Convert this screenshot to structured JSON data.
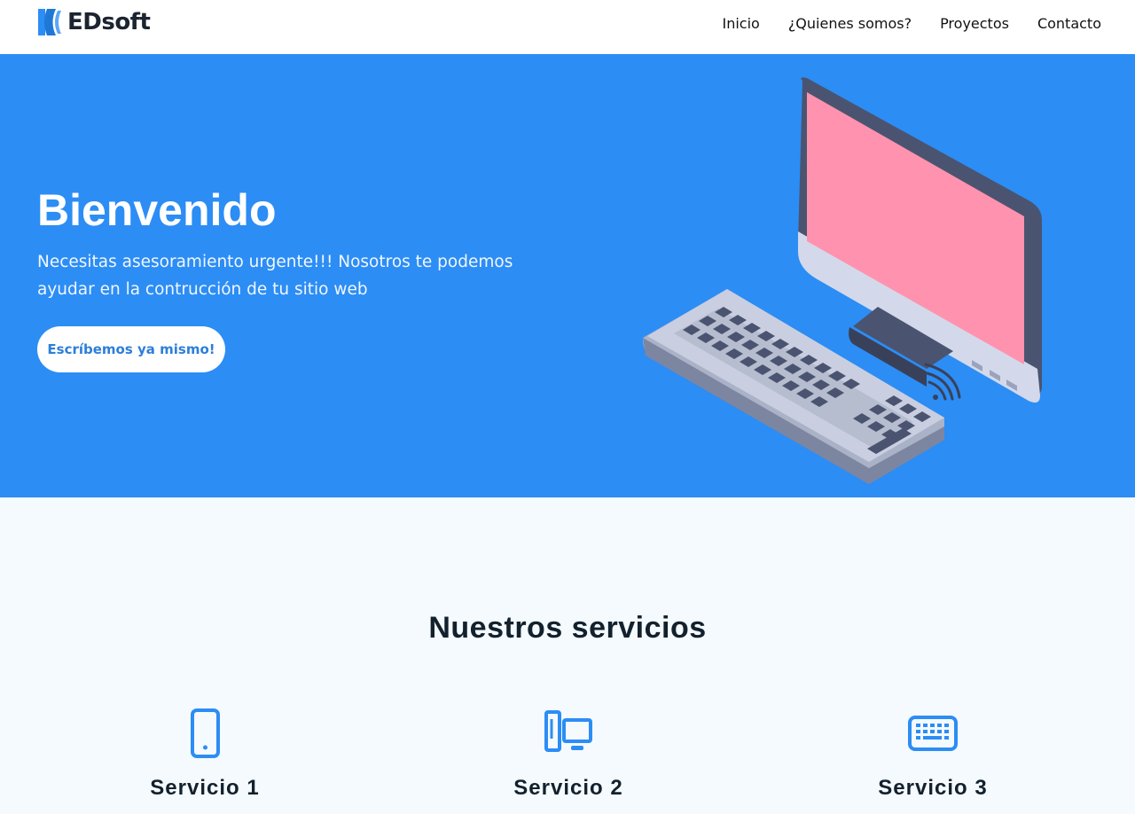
{
  "brand": {
    "name": "EDsoft",
    "accent": "#2c8df5"
  },
  "nav": {
    "items": [
      "Inicio",
      "¿Quienes somos?",
      "Proyectos",
      "Contacto"
    ]
  },
  "hero": {
    "title": "Bienvenido",
    "text": "Necesitas asesoramiento urgente!!! Nosotros te podemos ayudar en la contrucción de tu sitio web",
    "cta_label": "Escríbemos ya mismo!",
    "illustration": "desktop-computer-keyboard-illustration"
  },
  "services": {
    "title": "Nuestros servicios",
    "items": [
      {
        "label": "Servicio 1",
        "icon": "mobile-phone-icon"
      },
      {
        "label": "Servicio 2",
        "icon": "desktop-devices-icon"
      },
      {
        "label": "Servicio 3",
        "icon": "keyboard-icon"
      }
    ]
  }
}
